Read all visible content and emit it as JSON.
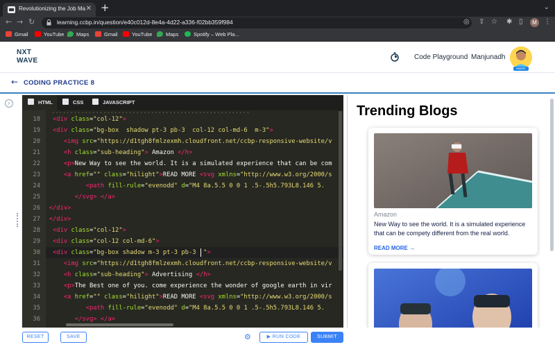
{
  "browser": {
    "tab_title": "Revolutionizing the Job Market",
    "url": "learning.ccbp.in/question/e40c012d-8e4a-4d22-a336-f02bb359f984",
    "profile_initial": "M",
    "bookmarks": [
      "Gmail",
      "YouTube",
      "Maps",
      "Gmail",
      "YouTube",
      "Maps",
      "Spotify – Web Pla..."
    ]
  },
  "header": {
    "logo_line1": "NXT",
    "logo_line2": "WAVE",
    "code_playground": "Code Playground",
    "username": "Manjunadh",
    "avatar_badge": "SMART"
  },
  "practice": {
    "title": "CODING PRACTICE 8"
  },
  "editor": {
    "tabs": [
      "HTML",
      "CSS",
      "JAVASCRIPT"
    ],
    "active_tab": "HTML",
    "line_numbers": [
      "18",
      "19",
      "20",
      "21",
      "22",
      "23",
      "24",
      "25",
      "26",
      "27",
      "28",
      "29",
      "30",
      "31",
      "32",
      "33",
      "34",
      "35",
      "36"
    ],
    "active_line": "30"
  },
  "actions": {
    "reset": "RESET",
    "save": "SAVE",
    "run_code": "RUN CODE",
    "submit": "SUBMIT"
  },
  "preview": {
    "heading": "Trending Blogs",
    "cards": [
      {
        "category": "Amazon",
        "description": "New Way to see the world. It is a simulated experience that can be compety different from the real world.",
        "read_more": "READ MORE →"
      },
      {
        "category": "",
        "description": "",
        "read_more": ""
      }
    ]
  },
  "colors": {
    "accent": "#3b82f6",
    "editor_bg": "#272822",
    "brand_dark": "#183b56"
  }
}
